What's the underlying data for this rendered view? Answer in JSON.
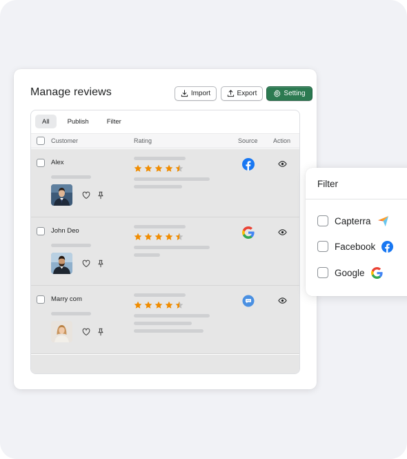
{
  "page": {
    "title": "Manage reviews",
    "buttons": {
      "import": "Import",
      "export": "Export",
      "setting": "Setting"
    }
  },
  "tabs": [
    "All",
    "Publish",
    "Filter"
  ],
  "columns": {
    "customer": "Customer",
    "rating": "Rating",
    "source": "Source",
    "action": "Action"
  },
  "reviews": [
    {
      "name": "Alex",
      "rating": 4.5,
      "source": "facebook-icon"
    },
    {
      "name": "John Deo",
      "rating": 4.5,
      "source": "google-icon"
    },
    {
      "name": "Marry com",
      "rating": 4.5,
      "source": "chat-bubble-icon"
    }
  ],
  "filter": {
    "title": "Filter",
    "options": [
      {
        "label": "Capterra",
        "icon": "capterra-icon"
      },
      {
        "label": "Facebook",
        "icon": "facebook-icon"
      },
      {
        "label": "Google",
        "icon": "google-icon"
      }
    ]
  },
  "colors": {
    "accent": "#2c7a51",
    "star": "#f08c00",
    "facebook": "#1877f2",
    "chat": "#4a90e2"
  }
}
